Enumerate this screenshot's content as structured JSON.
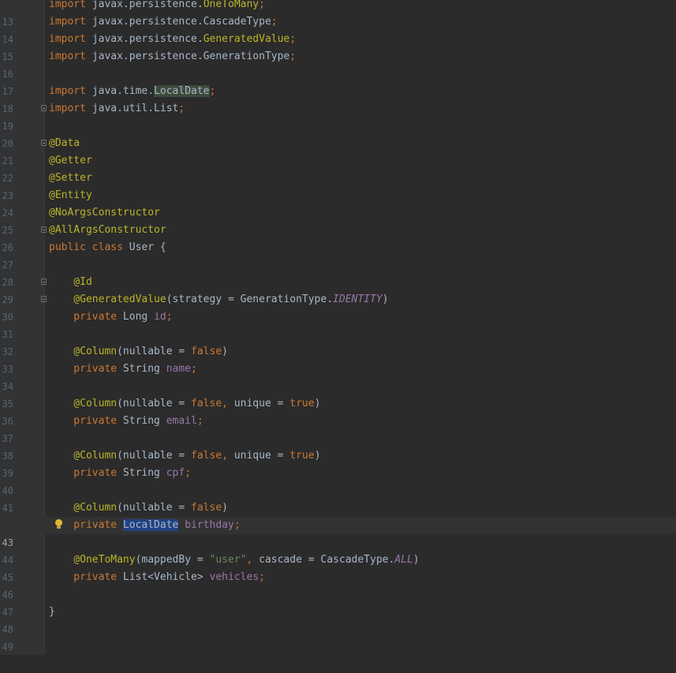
{
  "editor": {
    "current_line": "43",
    "lines": [
      {
        "n": "13",
        "a": "import",
        "b": " javax.persistence.",
        "c": "OneToMany",
        "d": ";"
      },
      {
        "n": "14",
        "a": "import",
        "b": " javax.persistence.CascadeType",
        "c": ";"
      },
      {
        "n": "15",
        "a": "import",
        "b": " javax.persistence.",
        "c": "GeneratedValue",
        "d": ";"
      },
      {
        "n": "16",
        "a": "import",
        "b": " javax.persistence.GenerationType",
        "c": ";"
      },
      {
        "n": "17"
      },
      {
        "n": "18",
        "a": "import",
        "b": " java.time.",
        "c": "LocalDate",
        "d": ";"
      },
      {
        "n": "19",
        "a": "import",
        "b": " java.util.List",
        "c": ";"
      },
      {
        "n": "20"
      },
      {
        "n": "21",
        "a": "@Data"
      },
      {
        "n": "22",
        "a": "@Getter"
      },
      {
        "n": "23",
        "a": "@Setter"
      },
      {
        "n": "24",
        "a": "@Entity"
      },
      {
        "n": "25",
        "a": "@NoArgsConstructor"
      },
      {
        "n": "26",
        "a": "@AllArgsConstructor"
      },
      {
        "n": "27",
        "a": "public class",
        "b": " User {"
      },
      {
        "n": "28"
      },
      {
        "n": "29",
        "a": "    @Id"
      },
      {
        "n": "30",
        "a": "    @GeneratedValue",
        "b": "(strategy = GenerationType.",
        "c": "IDENTITY",
        "d": ")"
      },
      {
        "n": "31",
        "a": "    private",
        "b": " Long ",
        "c": "id",
        "d": ";"
      },
      {
        "n": "32"
      },
      {
        "n": "33",
        "a": "    @Column",
        "b": "(nullable = ",
        "c": "false",
        "d": ")"
      },
      {
        "n": "34",
        "a": "    private",
        "b": " String ",
        "c": "name",
        "d": ";"
      },
      {
        "n": "35"
      },
      {
        "n": "36",
        "a": "    @Column",
        "b": "(nullable = ",
        "c": "false,",
        "d": " unique = ",
        "e": "true",
        "f": ")"
      },
      {
        "n": "37",
        "a": "    private",
        "b": " String ",
        "c": "email",
        "d": ";"
      },
      {
        "n": "38"
      },
      {
        "n": "39",
        "a": "    @Column",
        "b": "(nullable = ",
        "c": "false,",
        "d": " unique = ",
        "e": "true",
        "f": ")"
      },
      {
        "n": "40",
        "a": "    private",
        "b": " String ",
        "c": "cpf",
        "d": ";"
      },
      {
        "n": "41"
      },
      {
        "n": "42",
        "a": "    @Column",
        "b": "(nullable = ",
        "c": "false",
        "d": ")"
      },
      {
        "n": "43",
        "a": "    private",
        "b": " ",
        "c": "LocalDate",
        "d": " ",
        "e": "birthday",
        "f": ";"
      },
      {
        "n": "44"
      },
      {
        "n": "45",
        "a": "    @OneToMany",
        "b": "(mappedBy = ",
        "c": "\"user\"",
        "d": ",",
        "e": " cascade = CascadeType.",
        "f": "ALL",
        "g": ")"
      },
      {
        "n": "46",
        "a": "    private",
        "b": " List<Vehicle> ",
        "c": "vehicles",
        "d": ";"
      },
      {
        "n": "47"
      },
      {
        "n": "48",
        "a": "}"
      },
      {
        "n": "49"
      }
    ]
  }
}
